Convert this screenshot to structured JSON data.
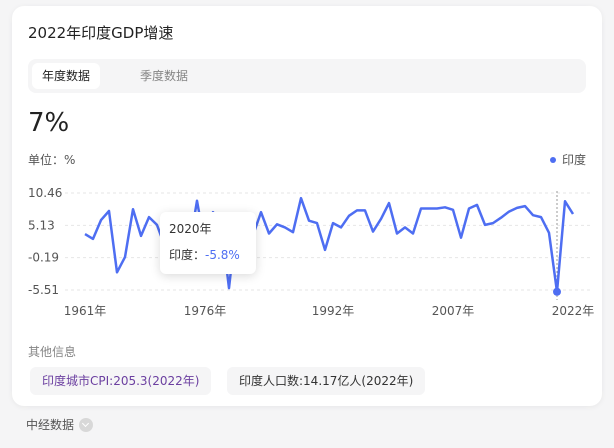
{
  "title": "2022年印度GDP增速",
  "tabs": [
    {
      "label": "年度数据",
      "active": true
    },
    {
      "label": "季度数据",
      "active": false
    }
  ],
  "current_value": "7%",
  "unit_label": "单位：%",
  "legend_label": "印度",
  "accent_color": "#4e6ef2",
  "tooltip": {
    "year": "2020年",
    "label": "印度：",
    "value": "-5.8%"
  },
  "other_info": {
    "title": "其他信息",
    "items": [
      "印度城市CPI:205.3(2022年)",
      "印度人口数:14.17亿人(2022年)"
    ]
  },
  "footer": {
    "label": "中经数据",
    "icon": "chevron-down-icon"
  },
  "chart_data": {
    "type": "line",
    "x": [
      1961,
      1962,
      1963,
      1964,
      1965,
      1966,
      1967,
      1968,
      1969,
      1970,
      1971,
      1972,
      1973,
      1974,
      1975,
      1976,
      1977,
      1978,
      1979,
      1980,
      1981,
      1982,
      1983,
      1984,
      1985,
      1986,
      1987,
      1988,
      1989,
      1990,
      1991,
      1992,
      1993,
      1994,
      1995,
      1996,
      1997,
      1998,
      1999,
      2000,
      2001,
      2002,
      2003,
      2004,
      2005,
      2006,
      2007,
      2008,
      2009,
      2010,
      2011,
      2012,
      2013,
      2014,
      2015,
      2016,
      2017,
      2018,
      2019,
      2020,
      2021,
      2022
    ],
    "series": [
      {
        "name": "印度",
        "values": [
          3.7,
          2.9,
          6.0,
          7.5,
          -2.6,
          -0.1,
          7.8,
          3.4,
          6.5,
          5.2,
          1.6,
          -0.6,
          3.3,
          1.2,
          9.2,
          1.7,
          7.3,
          5.7,
          -5.2,
          6.7,
          6.0,
          3.5,
          7.3,
          3.8,
          5.3,
          4.8,
          4.0,
          9.6,
          5.9,
          5.5,
          1.1,
          5.5,
          4.8,
          6.7,
          7.6,
          7.6,
          4.1,
          6.2,
          8.8,
          3.8,
          4.8,
          3.8,
          7.9,
          7.9,
          7.9,
          8.1,
          7.7,
          3.1,
          7.9,
          8.5,
          5.2,
          5.5,
          6.4,
          7.4,
          8.0,
          8.3,
          6.8,
          6.5,
          3.9,
          -5.8,
          9.1,
          7.0
        ]
      }
    ],
    "x_tick_labels": [
      "1961年",
      "1976年",
      "1992年",
      "2007年",
      "2022年"
    ],
    "y_tick_labels": [
      "10.46",
      "5.13",
      "-0.19",
      "-5.51"
    ],
    "ylim": [
      -5.51,
      10.46
    ],
    "highlight_year": 2020
  }
}
